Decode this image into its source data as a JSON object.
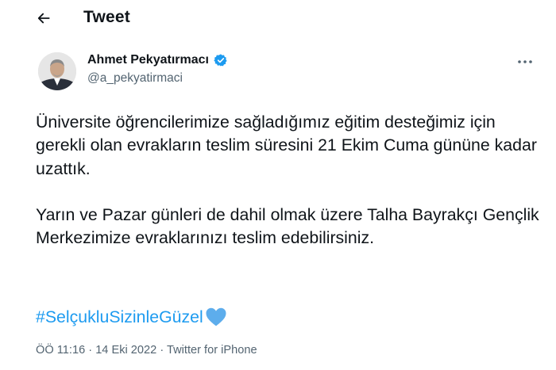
{
  "header": {
    "title": "Tweet"
  },
  "author": {
    "name": "Ahmet Pekyatırmacı",
    "handle": "@a_pekyatirmaci"
  },
  "tweet": {
    "paragraphs": [
      "Üniversite öğrencilerimize sağladığımız eğitim desteğimiz için gerekli olan evrakların teslim süresini 21 Ekim Cuma gününe kadar uzattık.",
      "Yarın ve Pazar günleri de dahil olmak üzere  Talha Bayrakçı Gençlik Merkezimize evraklarınızı teslim edebilirsiniz."
    ],
    "hashtag": "#SelçukluSizinleGüzel",
    "time": "ÖÖ 11:16",
    "separator1": " · ",
    "date": "14 Eki 2022",
    "separator2": " · ",
    "source": "Twitter for iPhone"
  },
  "icons": {
    "back": "back-arrow-icon",
    "verified": "verified-badge-icon",
    "more": "more-options-icon",
    "heart": "blue-heart-icon"
  },
  "colors": {
    "accent": "#1d9bf0",
    "text": "#0f1419",
    "muted": "#536471"
  }
}
